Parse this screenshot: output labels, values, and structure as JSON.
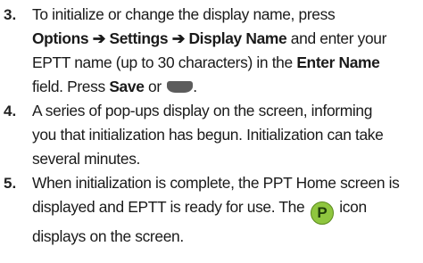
{
  "steps": [
    {
      "number": "3.",
      "line1": "To initialize or change the display name, press",
      "options": "Options",
      "arrow": "➔",
      "settings": "Settings",
      "display_name": "Display Name",
      "and_enter": " and enter your",
      "line3": "EPTT name (up to 30 characters) in the ",
      "enter_name": "Enter Name",
      "field_press": "field. Press ",
      "save": "Save",
      "or": " or ",
      "end": "."
    },
    {
      "number": "4.",
      "lines": [
        "A series of pop-ups display on the screen, informing",
        "you that initialization has begun. Initialization can take",
        "several minutes."
      ]
    },
    {
      "number": "5.",
      "line1": "When initialization is complete, the PPT Home screen is",
      "line2_pre": "displayed and EPTT is ready for use. The ",
      "icon_letter": "P",
      "line2_post": " icon",
      "line3": "displays on the screen."
    }
  ],
  "icons": {
    "softkey": "menu-softkey-icon",
    "ptt": "ptt-p-icon"
  },
  "colors": {
    "softkey": "#5c5c5c",
    "ptt_icon": "#8fc63f"
  }
}
